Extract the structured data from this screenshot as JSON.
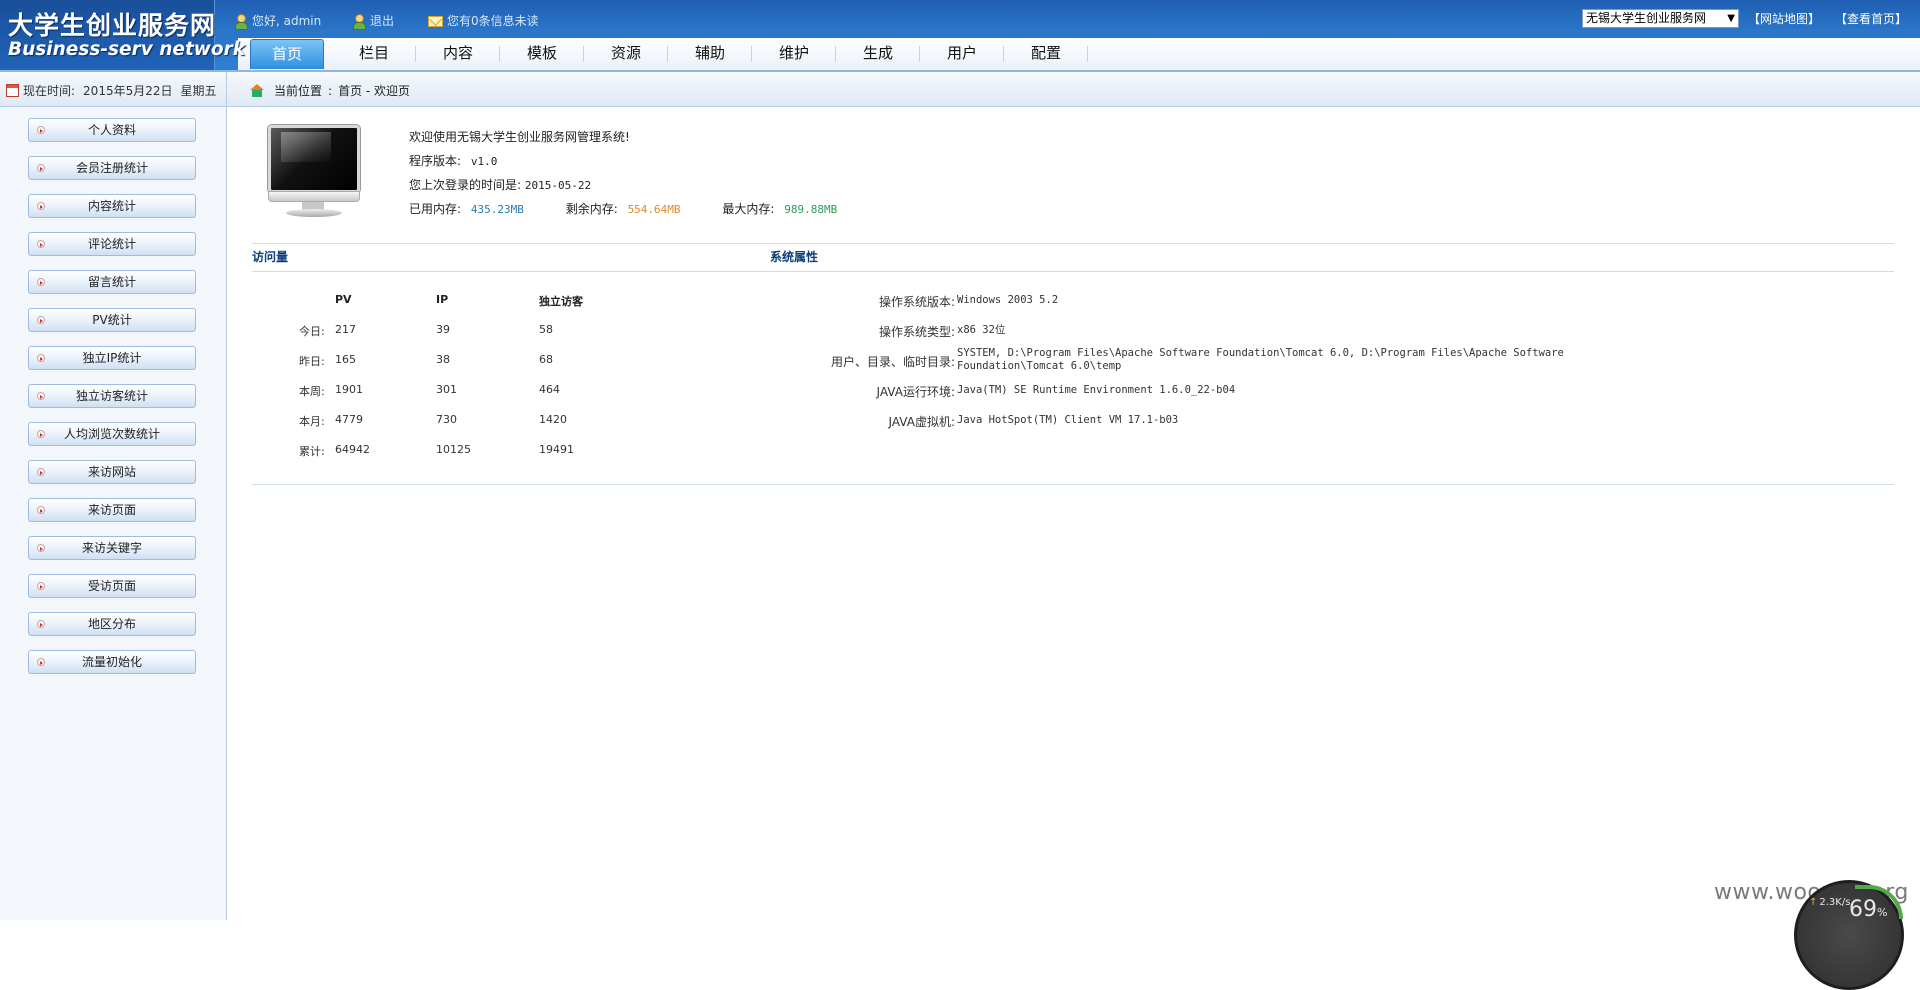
{
  "header": {
    "logo_cn": "大学生创业服务网",
    "logo_en": "Business-serv network",
    "greeting": "您好, admin",
    "logout": "退出",
    "messages": "您有0条信息未读",
    "site_select": "无锡大学生创业服务网",
    "sitemap_link": "【网站地图】",
    "home_link": "【查看首页】"
  },
  "nav": {
    "items": [
      "首页",
      "栏目",
      "内容",
      "模板",
      "资源",
      "辅助",
      "维护",
      "生成",
      "用户",
      "配置"
    ],
    "active": "首页"
  },
  "subbar": {
    "date_label": "现在时间:",
    "date": "2015年5月22日",
    "weekday": "星期五",
    "crumb_label": "当前位置",
    "crumb_sep": ":",
    "crumb_path": "首页 - 欢迎页"
  },
  "sidebar": {
    "items": [
      "个人资料",
      "会员注册统计",
      "内容统计",
      "评论统计",
      "留言统计",
      "PV统计",
      "独立IP统计",
      "独立访客统计",
      "人均浏览次数统计",
      "来访网站",
      "来访页面",
      "来访关键字",
      "受访页面",
      "地区分布",
      "流量初始化"
    ]
  },
  "welcome": {
    "line1": "欢迎使用无锡大学生创业服务网管理系统!",
    "version_label": "程序版本:",
    "version": "v1.0",
    "last_login_label": "您上次登录的时间是:",
    "last_login": "2015-05-22",
    "used_mem_label": "已用内存:",
    "used_mem": "435.23MB",
    "free_mem_label": "剩余内存:",
    "free_mem": "554.64MB",
    "max_mem_label": "最大内存:",
    "max_mem": "989.88MB",
    "colors": {
      "used": "#2a7ab0",
      "free": "#e08a1e",
      "max": "#2c9a5c"
    }
  },
  "visits": {
    "title": "访问量",
    "headers": [
      "PV",
      "IP",
      "独立访客"
    ],
    "rows": [
      {
        "label": "今日:",
        "pv": "217",
        "ip": "39",
        "uv": "58"
      },
      {
        "label": "昨日:",
        "pv": "165",
        "ip": "38",
        "uv": "68"
      },
      {
        "label": "本周:",
        "pv": "1901",
        "ip": "301",
        "uv": "464"
      },
      {
        "label": "本月:",
        "pv": "4779",
        "ip": "730",
        "uv": "1420"
      },
      {
        "label": "累计:",
        "pv": "64942",
        "ip": "10125",
        "uv": "19491"
      }
    ]
  },
  "system": {
    "title": "系统属性",
    "rows": [
      {
        "key": "操作系统版本:",
        "value": "Windows 2003 5.2"
      },
      {
        "key": "操作系统类型:",
        "value": "x86 32位"
      },
      {
        "key": "用户、目录、临时目录:",
        "value": "SYSTEM, D:\\Program Files\\Apache Software Foundation\\Tomcat 6.0, D:\\Program Files\\Apache Software Foundation\\Tomcat 6.0\\temp"
      },
      {
        "key": "JAVA运行环境:",
        "value": "Java(TM) SE Runtime Environment 1.6.0_22-b04"
      },
      {
        "key": "JAVA虚拟机:",
        "value": "Java HotSpot(TM) Client VM 17.1-b03"
      }
    ]
  },
  "overlay": {
    "watermark": "www.wooyun.org",
    "speed": "2.3K/s",
    "percent": "69",
    "percent_unit": "%"
  },
  "icons": [
    "user-icon",
    "logout-icon",
    "mail-icon",
    "calendar-icon",
    "home-icon",
    "monitor-icon",
    "arrow-bullet-icon"
  ]
}
